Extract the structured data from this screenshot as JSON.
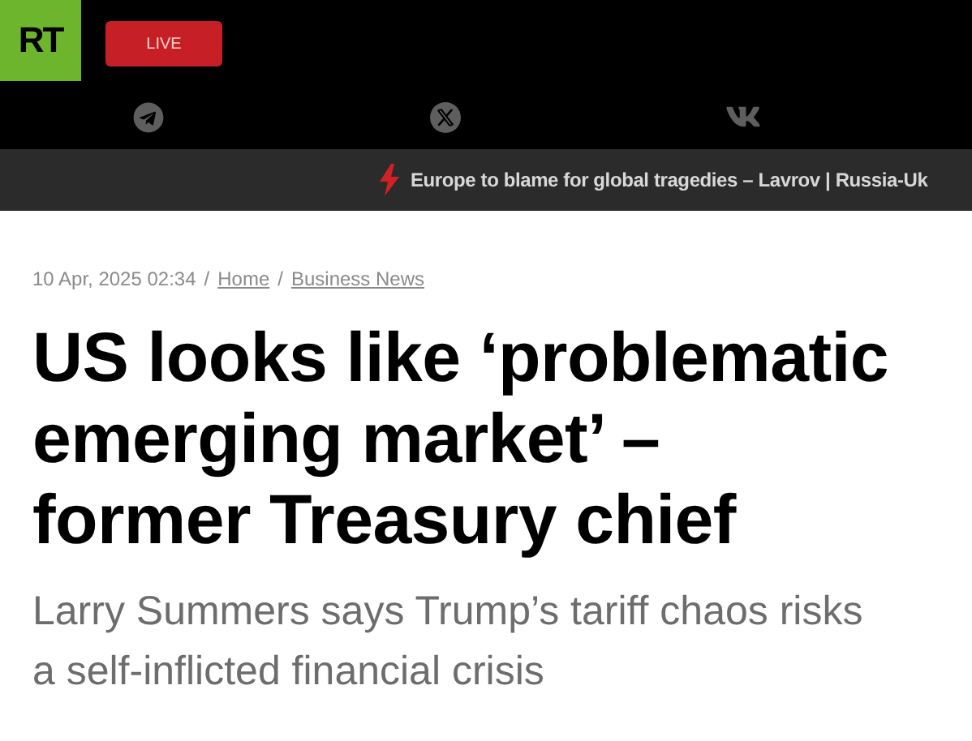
{
  "header": {
    "logo": "RT",
    "live_button": "LIVE"
  },
  "social": [
    {
      "kind": "telegram"
    },
    {
      "kind": "x"
    },
    {
      "kind": "vk"
    }
  ],
  "ticker": {
    "text": "Europe to blame for global tragedies – Lavrov | Russia-Uk"
  },
  "breadcrumb": {
    "date": "10 Apr, 2025 02:34",
    "separator": "/",
    "links": [
      "Home",
      "Business News"
    ]
  },
  "article": {
    "headline": [
      "US looks like ‘problematic",
      "emerging market’ –",
      "former Treasury chief"
    ],
    "subtitle": "Larry Summers says Trump’s tariff chaos risks a self-inflicted financial crisis"
  }
}
